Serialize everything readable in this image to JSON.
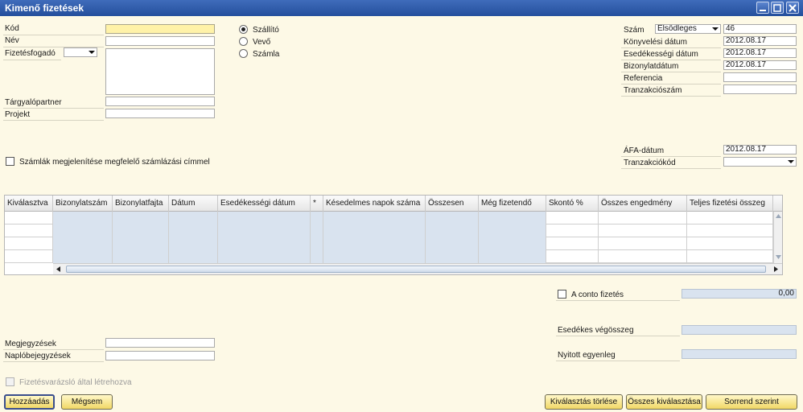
{
  "window": {
    "title": "Kimenő fizetések"
  },
  "left_form": {
    "kod_label": "Kód",
    "kod_value": "",
    "nev_label": "Név",
    "fizetesfogado_label": "Fizetésfogadó",
    "targyalopartner_label": "Tárgyalópartner",
    "projekt_label": "Projekt"
  },
  "partner_type": {
    "options": [
      "Szállító",
      "Vevő",
      "Számla"
    ],
    "selected": "Szállító"
  },
  "right_form": {
    "szam_label": "Szám",
    "szam_series": "Elsődleges",
    "szam_value": "46",
    "konyvelesi_label": "Könyvelési dátum",
    "konyvelesi_value": "2012.08.17",
    "esedekessegi_label": "Esedékességi dátum",
    "esedekessegi_value": "2012.08.17",
    "bizonylat_label": "Bizonylatdátum",
    "bizonylat_value": "2012.08.17",
    "referencia_label": "Referencia",
    "tranzakcioszam_label": "Tranzakciószám",
    "afa_label": "ÁFA-dátum",
    "afa_value": "2012.08.17",
    "tranzakciokod_label": "Tranzakciókód"
  },
  "show_invoices_label": "Számlák megjelenítése megfelelő számlázási címmel",
  "grid": {
    "columns": [
      "Kiválasztva",
      "Bizonylatszám",
      "Bizonylatfajta",
      "Dátum",
      "Esedékességi dátum",
      "*",
      "Késedelmes napok száma",
      "Összesen",
      "Még fizetendő",
      "Skontó %",
      "Összes engedmény",
      "Teljes fizetési összeg"
    ]
  },
  "aconto": {
    "label": "A conto fizetés",
    "value": "0,00"
  },
  "totals": {
    "esedekes_label": "Esedékes végösszeg",
    "nyitott_label": "Nyitott egyenleg"
  },
  "notes": {
    "megjegyzesek_label": "Megjegyzések",
    "naplo_label": "Naplóbejegyzések"
  },
  "wizard_label": "Fizetésvarázsló által létrehozva",
  "buttons": {
    "add": "Hozzáadás",
    "cancel": "Mégsem",
    "clear_selection": "Kiválasztás törlése",
    "select_all": "Összes kiválasztása",
    "by_order": "Sorrend szerint"
  },
  "colors": {
    "title_bar": "#2f5aa8",
    "background": "#fdf9e6",
    "button": "#f1d765",
    "readonly_cell": "#d9e3ef"
  }
}
